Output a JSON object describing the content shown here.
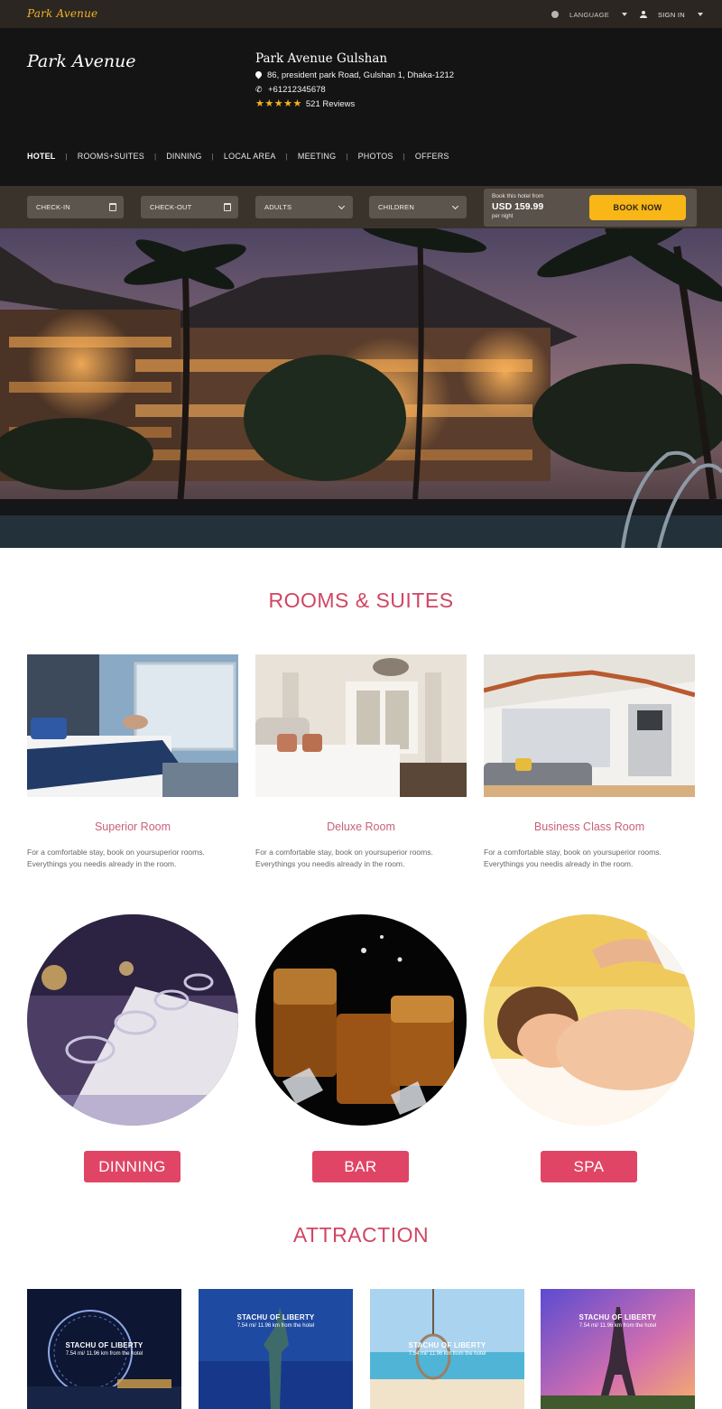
{
  "topbar": {
    "brand": "Park Avenue",
    "language_label": "LANGUAGE",
    "signin_label": "SIGN IN"
  },
  "header": {
    "logo": "Park Avenue",
    "hotel_name": "Park Avenue Gulshan",
    "address": "86, president park Road, Gulshan 1, Dhaka-1212",
    "phone": "+61212345678",
    "rating_stars": 5,
    "reviews": "521 Reviews"
  },
  "nav": {
    "items": [
      {
        "label": "HOTEL",
        "active": true
      },
      {
        "label": "ROOMS+SUITES"
      },
      {
        "label": "DINNING"
      },
      {
        "label": "LOCAL AREA"
      },
      {
        "label": "MEETING"
      },
      {
        "label": "PHOTOS"
      },
      {
        "label": "OFFERS"
      }
    ]
  },
  "booking": {
    "checkin": "CHECK-IN",
    "checkout": "CHECK-OUT",
    "adults": "ADULTS",
    "children": "CHILDREN",
    "price_from": "Book this hotel from",
    "price": "USD 159.99",
    "per_night": "per night",
    "book_now": "BOOK NOW"
  },
  "rooms": {
    "title": "ROOMS & SUITES",
    "items": [
      {
        "name": "Superior Room",
        "desc_line1": "For a comfortable stay, book on yoursuperior rooms.",
        "desc_line2": "Everythings you needis already in the room."
      },
      {
        "name": "Deluxe Room",
        "desc_line1": "For a comfortable stay, book on yoursuperior rooms.",
        "desc_line2": "Everythings you needis already in the room."
      },
      {
        "name": "Business Class Room",
        "desc_line1": "For a comfortable stay, book on yoursuperior rooms.",
        "desc_line2": "Everythings you needis already in the room."
      }
    ]
  },
  "facilities": {
    "items": [
      {
        "label": "DINNING"
      },
      {
        "label": "BAR"
      },
      {
        "label": "SPA"
      }
    ]
  },
  "attraction": {
    "title": "ATTRACTION",
    "items": [
      {
        "title": "STACHU OF LIBERTY",
        "distance": "7.54 mi/ 11.96 km from the hotel"
      },
      {
        "title": "STACHU OF LIBERTY",
        "distance": "7.54 mi/ 11.96 km from the hotel"
      },
      {
        "title": "STACHU OF LIBERTY",
        "distance": "7.54 mi/ 11.96 km from the hotel"
      },
      {
        "title": "STACHU OF LIBERTY",
        "distance": "7.54 mi/ 11.96 km from the hotel"
      }
    ]
  },
  "colors": {
    "accent": "#d14563",
    "book_button": "#f8b716",
    "header_bg": "#141414",
    "booking_bg": "#3a332c"
  }
}
